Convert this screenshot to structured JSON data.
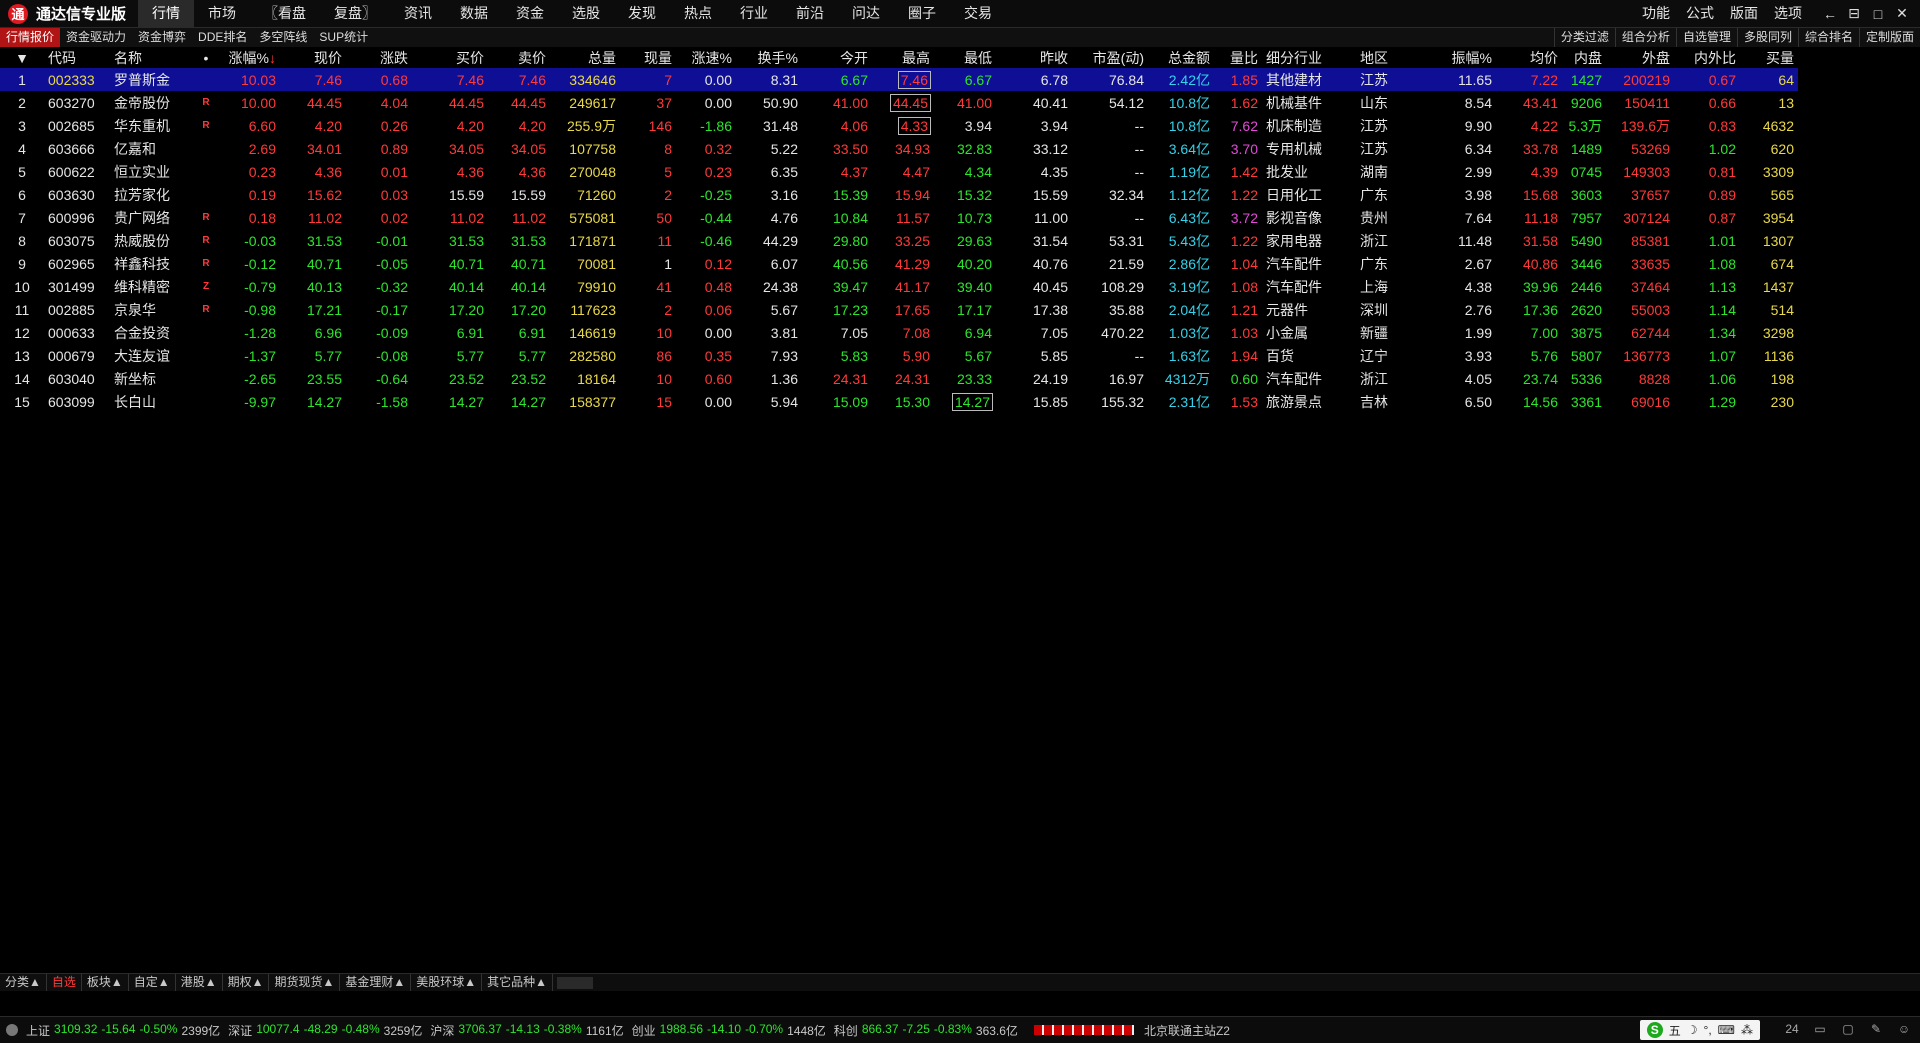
{
  "app": {
    "title": "通达信专业版",
    "logo": "通"
  },
  "menu": {
    "items": [
      "行情",
      "市场",
      "〖看盘",
      "复盘〗",
      "资讯",
      "数据",
      "资金",
      "选股",
      "发现",
      "热点",
      "行业",
      "前沿",
      "问达",
      "圈子",
      "交易"
    ],
    "active_index": 0,
    "right_items": [
      "功能",
      "公式",
      "版面",
      "选项"
    ],
    "window_controls": [
      "←",
      "⊟",
      "□",
      "✕"
    ]
  },
  "toolbar": {
    "left_tabs": [
      "行情报价",
      "资金驱动力",
      "资金博弈",
      "DDE排名",
      "多空阵线",
      "SUP统计"
    ],
    "active_index": 0,
    "right_tabs": [
      "分类过滤",
      "组合分析",
      "自选管理",
      "多股同列",
      "综合排名",
      "定制版面"
    ]
  },
  "table": {
    "sort_column": "涨幅%",
    "sort_indicator": "↓",
    "headers": [
      "",
      "代码",
      "名称",
      "•",
      "涨幅%",
      "现价",
      "涨跌",
      "买价",
      "卖价",
      "总量",
      "现量",
      "涨速%",
      "换手%",
      "今开",
      "最高",
      "最低",
      "昨收",
      "市盈(动)",
      "总金额",
      "量比",
      "细分行业",
      "地区",
      "振幅%",
      "均价",
      "内盘",
      "外盘",
      "内外比",
      "买量"
    ],
    "rows": [
      {
        "no": "1",
        "code": "002333",
        "name": "罗普斯金",
        "flag": "",
        "chg_pct": "10.03",
        "price": "7.46",
        "chg": "0.68",
        "bid": "7.46",
        "ask": "7.46",
        "vol": "334646",
        "cur_vol": "7",
        "speed": "0.00",
        "turnover": "8.31",
        "open": "6.67",
        "high": "7.46",
        "low": "6.67",
        "prev": "6.78",
        "pe": "76.84",
        "amount": "2.42亿",
        "vol_ratio": "1.85",
        "industry": "其他建材",
        "region": "江苏",
        "amp": "11.65",
        "avg": "7.22",
        "inner": "1427",
        "outer": "200219",
        "io_ratio": "0.67",
        "bid_vol": "64"
      },
      {
        "no": "2",
        "code": "603270",
        "name": "金帝股份",
        "flag": "R",
        "chg_pct": "10.00",
        "price": "44.45",
        "chg": "4.04",
        "bid": "44.45",
        "ask": "44.45",
        "vol": "249617",
        "cur_vol": "37",
        "speed": "0.00",
        "turnover": "50.90",
        "open": "41.00",
        "high": "44.45",
        "low": "41.00",
        "prev": "40.41",
        "pe": "54.12",
        "amount": "10.8亿",
        "vol_ratio": "1.62",
        "industry": "机械基件",
        "region": "山东",
        "amp": "8.54",
        "avg": "43.41",
        "inner": "9206",
        "outer": "150411",
        "io_ratio": "0.66",
        "bid_vol": "13"
      },
      {
        "no": "3",
        "code": "002685",
        "name": "华东重机",
        "flag": "R",
        "chg_pct": "6.60",
        "price": "4.20",
        "chg": "0.26",
        "bid": "4.20",
        "ask": "4.20",
        "vol": "255.9万",
        "cur_vol": "146",
        "speed": "-1.86",
        "turnover": "31.48",
        "open": "4.06",
        "high": "4.33",
        "low": "3.94",
        "prev": "3.94",
        "pe": "--",
        "amount": "10.8亿",
        "vol_ratio": "7.62",
        "industry": "机床制造",
        "region": "江苏",
        "amp": "9.90",
        "avg": "4.22",
        "inner": "5.3万",
        "outer": "139.6万",
        "io_ratio": "0.83",
        "bid_vol": "4632"
      },
      {
        "no": "4",
        "code": "603666",
        "name": "亿嘉和",
        "flag": "",
        "chg_pct": "2.69",
        "price": "34.01",
        "chg": "0.89",
        "bid": "34.05",
        "ask": "34.05",
        "vol": "107758",
        "cur_vol": "8",
        "speed": "0.32",
        "turnover": "5.22",
        "open": "33.50",
        "high": "34.93",
        "low": "32.83",
        "prev": "33.12",
        "pe": "--",
        "amount": "3.64亿",
        "vol_ratio": "3.70",
        "industry": "专用机械",
        "region": "江苏",
        "amp": "6.34",
        "avg": "33.78",
        "inner": "1489",
        "outer": "53269",
        "io_ratio": "1.02",
        "bid_vol": "620"
      },
      {
        "no": "5",
        "code": "600622",
        "name": "恒立实业",
        "flag": "",
        "chg_pct": "0.23",
        "price": "4.36",
        "chg": "0.01",
        "bid": "4.36",
        "ask": "4.36",
        "vol": "270048",
        "cur_vol": "5",
        "speed": "0.23",
        "turnover": "6.35",
        "open": "4.37",
        "high": "4.47",
        "low": "4.34",
        "prev": "4.35",
        "pe": "--",
        "amount": "1.19亿",
        "vol_ratio": "1.42",
        "industry": "批发业",
        "region": "湖南",
        "amp": "2.99",
        "avg": "4.39",
        "inner": "0745",
        "outer": "149303",
        "io_ratio": "0.81",
        "bid_vol": "3309"
      },
      {
        "no": "6",
        "code": "603630",
        "name": "拉芳家化",
        "flag": "",
        "chg_pct": "0.19",
        "price": "15.62",
        "chg": "0.03",
        "bid": "15.59",
        "ask": "15.59",
        "vol": "71260",
        "cur_vol": "2",
        "speed": "-0.25",
        "turnover": "3.16",
        "open": "15.39",
        "high": "15.94",
        "low": "15.32",
        "prev": "15.59",
        "pe": "32.34",
        "amount": "1.12亿",
        "vol_ratio": "1.22",
        "industry": "日用化工",
        "region": "广东",
        "amp": "3.98",
        "avg": "15.68",
        "inner": "3603",
        "outer": "37657",
        "io_ratio": "0.89",
        "bid_vol": "565"
      },
      {
        "no": "7",
        "code": "600996",
        "name": "贵广网络",
        "flag": "R",
        "chg_pct": "0.18",
        "price": "11.02",
        "chg": "0.02",
        "bid": "11.02",
        "ask": "11.02",
        "vol": "575081",
        "cur_vol": "50",
        "speed": "-0.44",
        "turnover": "4.76",
        "open": "10.84",
        "high": "11.57",
        "low": "10.73",
        "prev": "11.00",
        "pe": "--",
        "amount": "6.43亿",
        "vol_ratio": "3.72",
        "industry": "影视音像",
        "region": "贵州",
        "amp": "7.64",
        "avg": "11.18",
        "inner": "7957",
        "outer": "307124",
        "io_ratio": "0.87",
        "bid_vol": "3954"
      },
      {
        "no": "8",
        "code": "603075",
        "name": "热威股份",
        "flag": "R",
        "chg_pct": "-0.03",
        "price": "31.53",
        "chg": "-0.01",
        "bid": "31.53",
        "ask": "31.53",
        "vol": "171871",
        "cur_vol": "11",
        "speed": "-0.46",
        "turnover": "44.29",
        "open": "29.80",
        "high": "33.25",
        "low": "29.63",
        "prev": "31.54",
        "pe": "53.31",
        "amount": "5.43亿",
        "vol_ratio": "1.22",
        "industry": "家用电器",
        "region": "浙江",
        "amp": "11.48",
        "avg": "31.58",
        "inner": "5490",
        "outer": "85381",
        "io_ratio": "1.01",
        "bid_vol": "1307"
      },
      {
        "no": "9",
        "code": "602965",
        "name": "祥鑫科技",
        "flag": "R",
        "chg_pct": "-0.12",
        "price": "40.71",
        "chg": "-0.05",
        "bid": "40.71",
        "ask": "40.71",
        "vol": "70081",
        "cur_vol": "1",
        "speed": "0.12",
        "turnover": "6.07",
        "open": "40.56",
        "high": "41.29",
        "low": "40.20",
        "prev": "40.76",
        "pe": "21.59",
        "amount": "2.86亿",
        "vol_ratio": "1.04",
        "industry": "汽车配件",
        "region": "广东",
        "amp": "2.67",
        "avg": "40.86",
        "inner": "3446",
        "outer": "33635",
        "io_ratio": "1.08",
        "bid_vol": "674"
      },
      {
        "no": "10",
        "code": "301499",
        "name": "维科精密",
        "flag": "Z",
        "chg_pct": "-0.79",
        "price": "40.13",
        "chg": "-0.32",
        "bid": "40.14",
        "ask": "40.14",
        "vol": "79910",
        "cur_vol": "41",
        "speed": "0.48",
        "turnover": "24.38",
        "open": "39.47",
        "high": "41.17",
        "low": "39.40",
        "prev": "40.45",
        "pe": "108.29",
        "amount": "3.19亿",
        "vol_ratio": "1.08",
        "industry": "汽车配件",
        "region": "上海",
        "amp": "4.38",
        "avg": "39.96",
        "inner": "2446",
        "outer": "37464",
        "io_ratio": "1.13",
        "bid_vol": "1437"
      },
      {
        "no": "11",
        "code": "002885",
        "name": "京泉华",
        "flag": "R",
        "chg_pct": "-0.98",
        "price": "17.21",
        "chg": "-0.17",
        "bid": "17.20",
        "ask": "17.20",
        "vol": "117623",
        "cur_vol": "2",
        "speed": "0.06",
        "turnover": "5.67",
        "open": "17.23",
        "high": "17.65",
        "low": "17.17",
        "prev": "17.38",
        "pe": "35.88",
        "amount": "2.04亿",
        "vol_ratio": "1.21",
        "industry": "元器件",
        "region": "深圳",
        "amp": "2.76",
        "avg": "17.36",
        "inner": "2620",
        "outer": "55003",
        "io_ratio": "1.14",
        "bid_vol": "514"
      },
      {
        "no": "12",
        "code": "000633",
        "name": "合金投资",
        "flag": "",
        "chg_pct": "-1.28",
        "price": "6.96",
        "chg": "-0.09",
        "bid": "6.91",
        "ask": "6.91",
        "vol": "146619",
        "cur_vol": "10",
        "speed": "0.00",
        "turnover": "3.81",
        "open": "7.05",
        "high": "7.08",
        "low": "6.94",
        "prev": "7.05",
        "pe": "470.22",
        "amount": "1.03亿",
        "vol_ratio": "1.03",
        "industry": "小金属",
        "region": "新疆",
        "amp": "1.99",
        "avg": "7.00",
        "inner": "3875",
        "outer": "62744",
        "io_ratio": "1.34",
        "bid_vol": "3298"
      },
      {
        "no": "13",
        "code": "000679",
        "name": "大连友谊",
        "flag": "",
        "chg_pct": "-1.37",
        "price": "5.77",
        "chg": "-0.08",
        "bid": "5.77",
        "ask": "5.77",
        "vol": "282580",
        "cur_vol": "86",
        "speed": "0.35",
        "turnover": "7.93",
        "open": "5.83",
        "high": "5.90",
        "low": "5.67",
        "prev": "5.85",
        "pe": "--",
        "amount": "1.63亿",
        "vol_ratio": "1.94",
        "industry": "百货",
        "region": "辽宁",
        "amp": "3.93",
        "avg": "5.76",
        "inner": "5807",
        "outer": "136773",
        "io_ratio": "1.07",
        "bid_vol": "1136"
      },
      {
        "no": "14",
        "code": "603040",
        "name": "新坐标",
        "flag": "",
        "chg_pct": "-2.65",
        "price": "23.55",
        "chg": "-0.64",
        "bid": "23.52",
        "ask": "23.52",
        "vol": "18164",
        "cur_vol": "10",
        "speed": "0.60",
        "turnover": "1.36",
        "open": "24.31",
        "high": "24.31",
        "low": "23.33",
        "prev": "24.19",
        "pe": "16.97",
        "amount": "4312万",
        "vol_ratio": "0.60",
        "industry": "汽车配件",
        "region": "浙江",
        "amp": "4.05",
        "avg": "23.74",
        "inner": "5336",
        "outer": "8828",
        "io_ratio": "1.06",
        "bid_vol": "198"
      },
      {
        "no": "15",
        "code": "603099",
        "name": "长白山",
        "flag": "",
        "chg_pct": "-9.97",
        "price": "14.27",
        "chg": "-1.58",
        "bid": "14.27",
        "ask": "14.27",
        "vol": "158377",
        "cur_vol": "15",
        "speed": "0.00",
        "turnover": "5.94",
        "open": "15.09",
        "high": "15.30",
        "low": "14.27",
        "prev": "15.85",
        "pe": "155.32",
        "amount": "2.31亿",
        "vol_ratio": "1.53",
        "industry": "旅游景点",
        "region": "吉林",
        "amp": "6.50",
        "avg": "14.56",
        "inner": "3361",
        "outer": "69016",
        "io_ratio": "1.29",
        "bid_vol": "230"
      }
    ]
  },
  "sheet_tabs": {
    "items": [
      "分类▲",
      "自选",
      "板块▲",
      "自定▲",
      "港股▲",
      "期权▲",
      "期货现货▲",
      "基金理财▲",
      "美股环球▲",
      "其它品种▲"
    ],
    "active_index": 1
  },
  "status": {
    "indices": [
      {
        "name": "上证",
        "value": "3109.32",
        "change": "-15.64",
        "pct": "-0.50%",
        "amount": "2399亿"
      },
      {
        "name": "深证",
        "value": "10077.4",
        "change": "-48.29",
        "pct": "-0.48%",
        "amount": "3259亿"
      },
      {
        "name": "沪深",
        "value": "3706.37",
        "change": "-14.13",
        "pct": "-0.38%",
        "amount": "1161亿"
      },
      {
        "name": "创业",
        "value": "1988.56",
        "change": "-14.10",
        "pct": "-0.70%",
        "amount": "1448亿"
      },
      {
        "name": "科创",
        "value": "866.37",
        "change": "-7.25",
        "pct": "-0.83%",
        "amount": "363.6亿"
      }
    ],
    "server": "北京联通主站Z2",
    "ime": [
      "S",
      "五",
      "☽",
      "°,",
      "⌨",
      "⁂"
    ],
    "clock_fragment": "24"
  },
  "colors": {
    "up": "#ff3a3a",
    "down": "#2ee52e",
    "flat": "#e6e6e6",
    "volume": "#e9d94a",
    "amount": "#35d2ea",
    "selected_row": "#0f0f95",
    "active_tab": "#b01414"
  }
}
